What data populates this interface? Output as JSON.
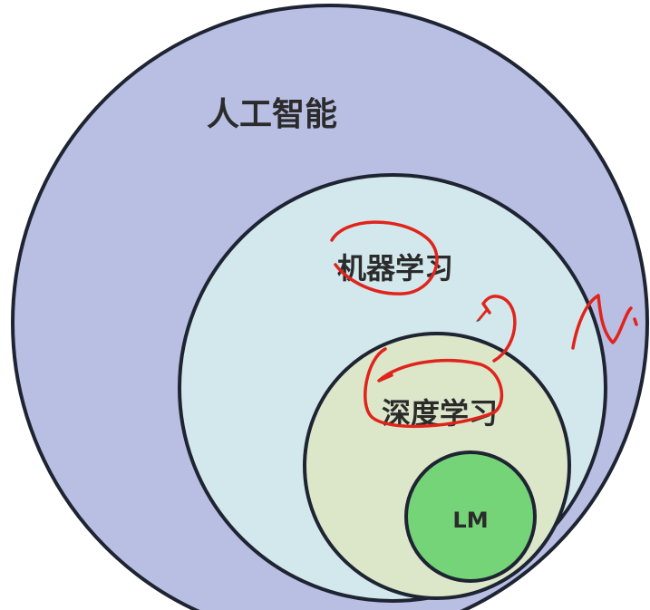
{
  "diagram": {
    "circles": [
      {
        "id": "ai",
        "label": "人工智能",
        "fill": "#b9bfe3"
      },
      {
        "id": "ml",
        "label": "机器学习",
        "fill": "#d2e8ec"
      },
      {
        "id": "dl",
        "label": "深度学习",
        "fill": "#dce7ca"
      },
      {
        "id": "lm",
        "label": "LM",
        "fill": "#74d477"
      }
    ],
    "stroke_color": "#1f2433",
    "annotation_color": "#e0241c"
  }
}
